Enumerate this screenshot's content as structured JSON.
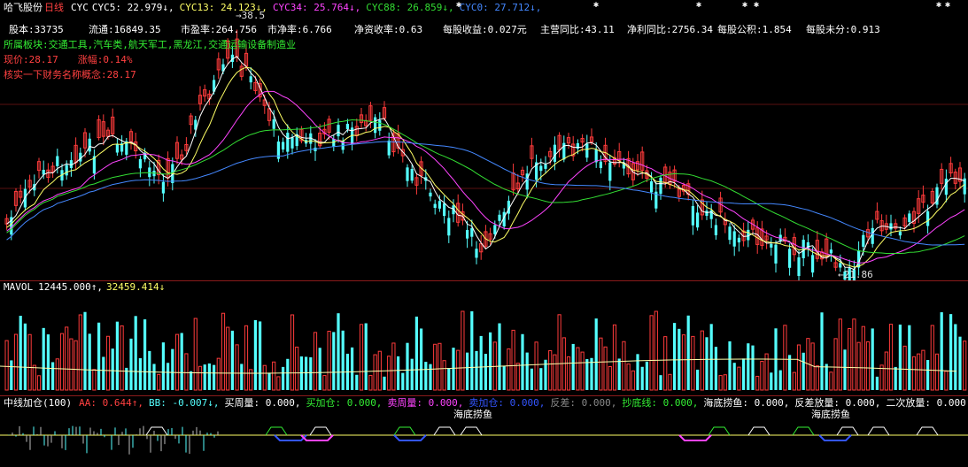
{
  "colors": {
    "up": "#ff3b3b",
    "down": "#54ffff",
    "bg": "#000000",
    "border": "#8a1b1b",
    "ma5": "#ffffff",
    "ma13": "#ffff66",
    "ma34": "#ff44ff",
    "ma88": "#33dd33",
    "ma0": "#4488ff"
  },
  "header": {
    "stock_name": "哈飞股份",
    "period": "日线",
    "indicator_name": "CYC",
    "cyc5": "CYC5: 22.979↓,",
    "cyc13": "CYC13: 24.123↓,",
    "cyc34": "CYC34: 25.764↓,",
    "cyc88": "CYC88: 26.859↓,",
    "cyc0": "CYC0: 27.712↓,"
  },
  "info_row": [
    {
      "label": "股本:33735"
    },
    {
      "label": "流通:16849.35"
    },
    {
      "label": "市盈率:264.756"
    },
    {
      "label": "市净率:6.766"
    },
    {
      "label": "净资收率:0.63"
    },
    {
      "label": "每股收益:0.027元"
    },
    {
      "label": "主营同比:43.11"
    },
    {
      "label": "净利同比:2756.34"
    },
    {
      "label": "每股公积:1.854"
    },
    {
      "label": "每股未分:0.913"
    }
  ],
  "sector_line": "所属板块:交通工具,汽车类,航天军工,黑龙江,交通运输设备制造业",
  "price_line": {
    "now": "现价:28.17",
    "chg": "涨幅:0.14%"
  },
  "note_line": "核实一下财务名称概念:28.17",
  "price_marks": {
    "high": "38.5",
    "low": "21.86"
  },
  "volume_header": {
    "name": "MAVOL",
    "v1": "12445.000↑,",
    "v2": "32459.414↓"
  },
  "indicator_header": {
    "name": "中线加仓(100)",
    "aa": "AA: 0.644↑,",
    "bb": "BB: -0.007↓,",
    "buy_week": "买周量: 0.000,",
    "add_pos": "买加仓: 0.000,",
    "sell_week": "卖周量: 0.000,",
    "sell_add": "卖加仓: 0.000,",
    "reverse": "反差: 0.000,",
    "bottom_line": "抄底线: 0.000,",
    "fish": "海底捞鱼: 0.000,",
    "rev_vol": "反差放量: 0.000,",
    "second_vol": "二次放量: 0.000"
  },
  "fish_labels": [
    "海底捞鱼",
    "海底捞鱼"
  ]
}
